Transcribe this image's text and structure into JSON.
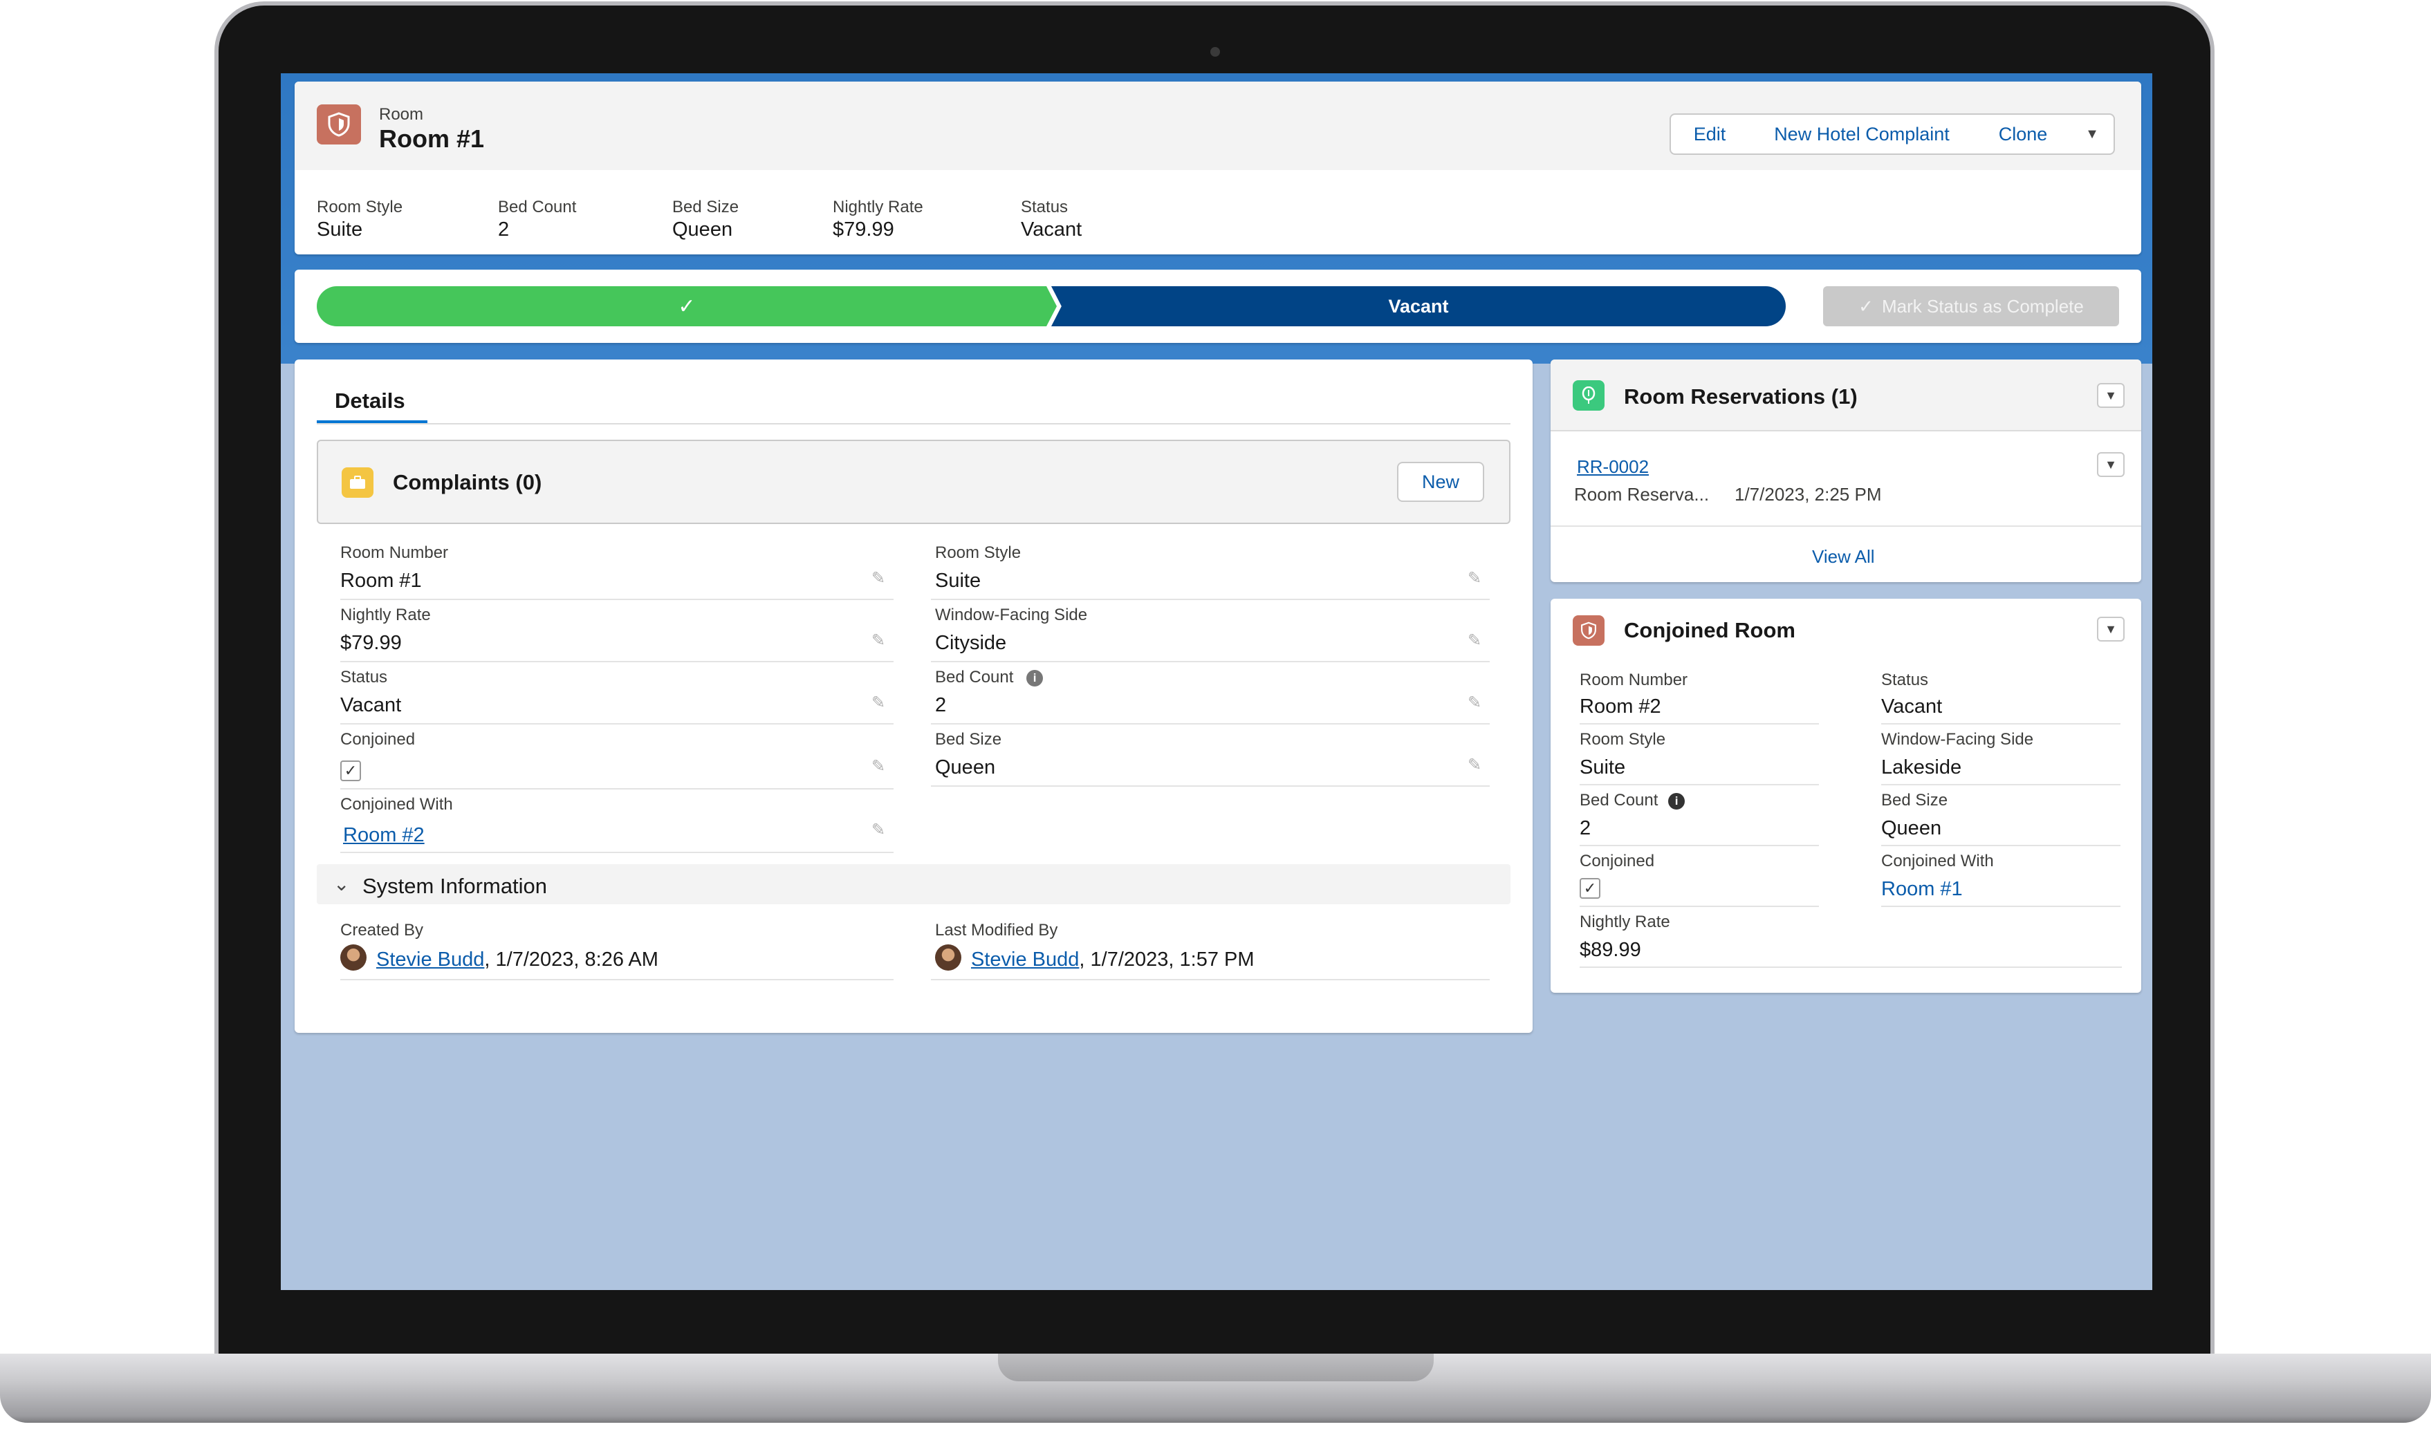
{
  "header": {
    "object_label": "Room",
    "record_title": "Room #1",
    "actions": {
      "edit": "Edit",
      "new_complaint": "New Hotel Complaint",
      "clone": "Clone"
    }
  },
  "highlights": [
    {
      "label": "Room Style",
      "value": "Suite"
    },
    {
      "label": "Bed Count",
      "value": "2"
    },
    {
      "label": "Bed Size",
      "value": "Queen"
    },
    {
      "label": "Nightly Rate",
      "value": "$79.99"
    },
    {
      "label": "Status",
      "value": "Vacant"
    }
  ],
  "path": {
    "completed_icon": "check-icon",
    "current_stage": "Vacant",
    "mark_complete": "Mark Status as Complete",
    "colors": {
      "completed": "#45c65a",
      "current": "#014486",
      "button_disabled": "#c9c9c9"
    }
  },
  "details": {
    "tab": "Details",
    "complaints": {
      "title": "Complaints (0)",
      "new_label": "New"
    },
    "left_fields": [
      {
        "label": "Room Number",
        "value": "Room #1"
      },
      {
        "label": "Nightly Rate",
        "value": "$79.99"
      },
      {
        "label": "Status",
        "value": "Vacant"
      },
      {
        "label": "Conjoined",
        "value": "✓"
      },
      {
        "label": "Conjoined With",
        "value": "Room #2"
      }
    ],
    "right_fields": [
      {
        "label": "Room Style",
        "value": "Suite"
      },
      {
        "label": "Window-Facing Side",
        "value": "Cityside"
      },
      {
        "label": "Bed Count",
        "value": "2"
      },
      {
        "label": "Bed Size",
        "value": "Queen"
      }
    ],
    "system_info": {
      "title": "System Information",
      "created_by_label": "Created By",
      "created_by_user": "Stevie Budd",
      "created_by_date": ", 1/7/2023, 8:26 AM",
      "modified_by_label": "Last Modified By",
      "modified_by_user": "Stevie Budd",
      "modified_by_date": ", 1/7/2023, 1:57 PM"
    }
  },
  "reservations": {
    "title": "Room Reservations (1)",
    "record_link": "RR-0002",
    "record_type": "Room Reserva...",
    "record_date": "1/7/2023, 2:25 PM",
    "view_all": "View All"
  },
  "conjoined_room": {
    "title": "Conjoined Room",
    "left_fields": [
      {
        "label": "Room Number",
        "value": "Room #2"
      },
      {
        "label": "Room Style",
        "value": "Suite"
      },
      {
        "label": "Bed Count",
        "value": "2"
      },
      {
        "label": "Conjoined",
        "value": "✓"
      },
      {
        "label": "Nightly Rate",
        "value": "$89.99"
      }
    ],
    "right_fields": [
      {
        "label": "Status",
        "value": "Vacant"
      },
      {
        "label": "Window-Facing Side",
        "value": "Lakeside"
      },
      {
        "label": "Bed Size",
        "value": "Queen"
      },
      {
        "label": "Conjoined With",
        "value": "Room #1"
      }
    ]
  },
  "icons": {
    "room": "room-shield-icon",
    "complaints": "briefcase-icon",
    "reservations": "balloon-icon",
    "pencil": "pencil-icon",
    "info": "info-icon"
  },
  "colors": {
    "room_icon": "#c7715f",
    "complaints_icon": "#f4c542",
    "reservations_icon": "#3bc97e",
    "link": "#0b5cab",
    "background": "#afc4df"
  }
}
